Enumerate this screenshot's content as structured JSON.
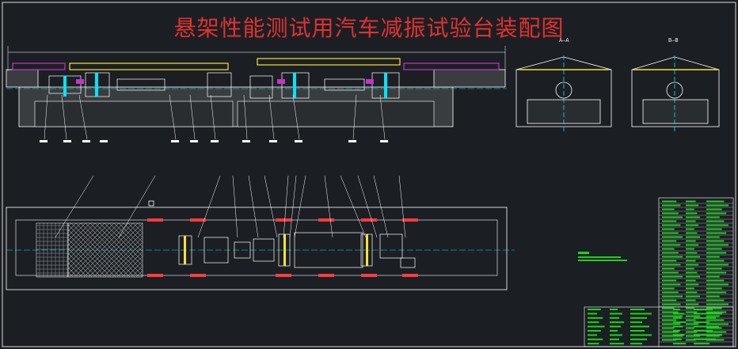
{
  "drawing": {
    "title": "悬架性能测试用汽车减振试验台装配图",
    "section_a_label": "A—A",
    "section_b_label": "B—B"
  },
  "colors": {
    "background": "#1b1f24",
    "title": "#e0322f",
    "outline": "#ffffff",
    "centerline": "#00e5ff",
    "rail": "#f7e13a",
    "magenta": "#c534c9",
    "hatch": "#9a9a9a",
    "table_green": "#1fd11f",
    "red_part": "#ff3b3b"
  },
  "icons": {
    "balloon": "leader-line-icon",
    "grid": "hatch-pattern-icon"
  }
}
